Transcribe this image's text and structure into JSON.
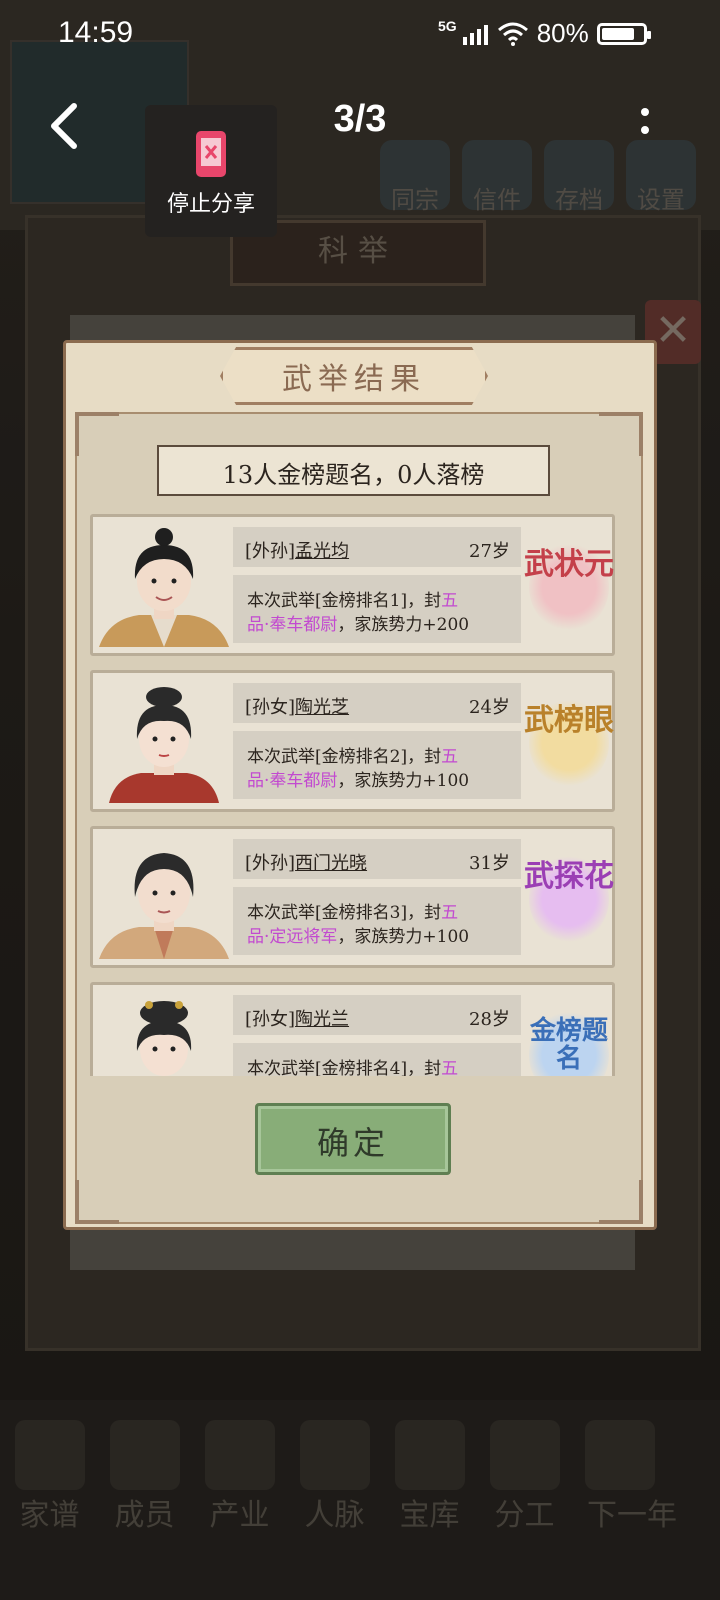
{
  "status_bar": {
    "time": "14:59",
    "network": "5G",
    "battery": "80%",
    "battery_level": 0.8
  },
  "nav": {
    "page_indicator": "3/3",
    "share_label": "停止分享"
  },
  "background": {
    "top_icons": [
      "同宗",
      "信件",
      "存档",
      "设置"
    ],
    "board_title": "科举",
    "bottom_menu": [
      "家谱",
      "成员",
      "产业",
      "人脉",
      "宝库",
      "分工",
      "下一年"
    ]
  },
  "dialog": {
    "title": "武举结果",
    "summary": "13人金榜题名，0人落榜",
    "results": [
      {
        "relation": "[外孙]",
        "name": "孟光均",
        "age": "27岁",
        "desc_a": "本次武举[金榜排名1]，封",
        "desc_title_a": "五",
        "desc_title_b": "品·奉车都尉",
        "desc_b": "，家族势力+200",
        "badge": "武状元",
        "badge_color": "#c4404a",
        "badge_glow": "#f0c1c4"
      },
      {
        "relation": "[孙女]",
        "name": "陶光芝",
        "age": "24岁",
        "desc_a": "本次武举[金榜排名2]，封",
        "desc_title_a": "五",
        "desc_title_b": "品·奉车都尉",
        "desc_b": "，家族势力+100",
        "badge": "武榜眼",
        "badge_color": "#b9812a",
        "badge_glow": "#f2dca0"
      },
      {
        "relation": "[外孙]",
        "name": "西门光晓",
        "age": "31岁",
        "desc_a": "本次武举[金榜排名3]，封",
        "desc_title_a": "五",
        "desc_title_b": "品·定远将军",
        "desc_b": "，家族势力+100",
        "badge": "武探花",
        "badge_color": "#9b3fb4",
        "badge_glow": "#e6bdf0"
      },
      {
        "relation": "[孙女]",
        "name": "陶光兰",
        "age": "28岁",
        "desc_a": "本次武举[金榜排名4]，封",
        "desc_title_a": "五",
        "desc_title_b": "",
        "desc_b": "",
        "badge": "金榜题名",
        "badge_color": "#3a6fb8",
        "badge_glow": "#bcd4f0"
      }
    ],
    "confirm_label": "确定"
  }
}
